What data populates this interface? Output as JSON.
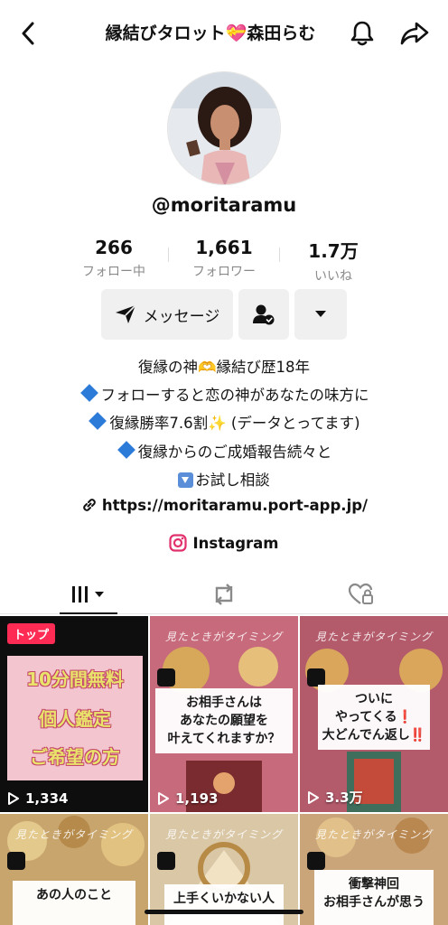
{
  "header": {
    "title": "縁結びタロット💝森田らむ"
  },
  "profile": {
    "username": "@moritaramu",
    "stats": [
      {
        "value": "266",
        "label": "フォロー中"
      },
      {
        "value": "1,661",
        "label": "フォロワー"
      },
      {
        "value": "1.7万",
        "label": "いいね"
      }
    ]
  },
  "actions": {
    "message_label": "メッセージ"
  },
  "bio": {
    "line1": "復縁の神🫶縁結び歴18年",
    "line2": "フォローすると恋の神があなたの味方に",
    "line3": "復縁勝率7.6割✨ (データとってます)",
    "line4": "復縁からのご成婚報告続々と",
    "line5": "お試し相談",
    "link": "https://moritaramu.port-app.jp/",
    "instagram": "Instagram"
  },
  "videos": [
    {
      "views": "1,334",
      "tag": "トップ",
      "lines": [
        "10分間無料",
        "個人鑑定",
        "ご希望の方"
      ]
    },
    {
      "views": "1,193",
      "header": "見たときがタイミング",
      "caption": [
        "お相手さんは",
        "あなたの願望を",
        "叶えてくれますか？"
      ]
    },
    {
      "views": "3.3万",
      "header": "見たときがタイミング",
      "caption": [
        "ついに",
        "やってくる❗",
        "大どんでん返し‼️"
      ]
    },
    {
      "header": "見たときがタイミング",
      "caption": [
        "あの人のこと"
      ]
    },
    {
      "header": "見たときがタイミング",
      "caption": [
        "上手くいかない人"
      ]
    },
    {
      "header": "見たときがタイミング",
      "caption": [
        "衝撃神回",
        "お相手さんが思う"
      ]
    }
  ]
}
